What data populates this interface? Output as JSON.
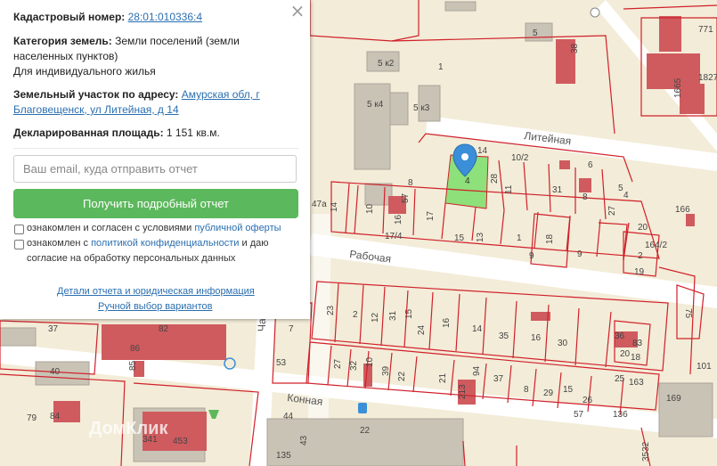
{
  "panel": {
    "close_icon": "×",
    "cadastral_label": "Кадастровый номер:",
    "cadastral_value": "28:01:010336:4",
    "category_label": "Категория земель:",
    "category_value_1": "Земли поселений (земли",
    "category_value_2": "населенных пунктов)",
    "category_value_3": "Для индивидуального жилья",
    "address_label": "Земельный участок по адресу:",
    "address_value_1": "Амурская обл, г",
    "address_value_2": "Благовещенск, ул Литейная, д 14",
    "area_label": "Декларированная площадь:",
    "area_value": "1 151 кв.м.",
    "email_placeholder": "Ваш email, куда отправить отчет",
    "submit_label": "Получить подробный отчет",
    "consent1_text": "ознакомлен и согласен с условиями",
    "consent1_link": "публичной оферты",
    "consent2_text_a": "ознакомлен с",
    "consent2_link_a": "политикой конфиденциальности",
    "consent2_text_b": "и даю",
    "consent2_link_b": "согласие на обработку персональных данных",
    "details_link": "Детали отчета и юридическая информация",
    "manual_link": "Ручной выбор вариантов"
  },
  "map": {
    "streets": {
      "liteynaya": "Литейная",
      "rabochaya": "Рабочая",
      "konnaya": "Конная",
      "cha": "Ча"
    },
    "labels": {
      "b5k2": "5 к2",
      "b5k4": "5 к4",
      "b5k3": "5 к3",
      "b5": "5",
      "b1": "1",
      "b38": "38",
      "b771": "771",
      "b1665": "1665",
      "b1827": "1827",
      "p14a": "14",
      "p10_2": "10/2",
      "p8a": "8",
      "p28": "28",
      "p11a": "11",
      "p31": "31",
      "p8b": "8",
      "p6": "6",
      "p5": "5",
      "p4": "4",
      "p27": "27",
      "p166": "166",
      "p47a": "47а",
      "p14b": "14",
      "p10a": "10",
      "p16": "16",
      "p57": "57",
      "p17": "17",
      "p15": "15",
      "p13": "13",
      "p1": "1",
      "p18": "18",
      "p9a": "9",
      "p9b": "9",
      "p20": "20",
      "p2": "2",
      "p19": "19",
      "p164": "164/2",
      "p1674": "17/4",
      "q23": "23",
      "q2": "2",
      "q12": "12",
      "q31": "31",
      "q15": "15",
      "q24": "24",
      "q16": "16",
      "q14": "14",
      "q35": "35",
      "q16b": "16",
      "q30": "30",
      "q36": "36",
      "q83": "83",
      "q20": "20",
      "q18": "18",
      "q75": "75",
      "q101": "101",
      "q7": "7",
      "q53": "53",
      "q27": "27",
      "q32": "32",
      "q10": "10",
      "q39": "39",
      "q22": "22",
      "q21": "21",
      "q94": "94",
      "q37": "37",
      "q8": "8",
      "q29": "29",
      "q15b": "15",
      "q26": "26",
      "q57": "57",
      "q25": "25",
      "q163": "163",
      "q136": "136",
      "r86": "86",
      "r82": "82",
      "r85": "85",
      "r40": "40",
      "r79": "79",
      "r84": "84",
      "r341": "341",
      "r453": "453",
      "r44": "44",
      "r22": "22",
      "r213": "213",
      "r43": "43",
      "r135": "135",
      "r169": "169",
      "r3532": "3532",
      "r37": "37",
      "sel4": "4"
    },
    "watermark": "ДомКлик"
  },
  "colors": {
    "map_bg": "#f3ecd8",
    "parcel_line": "#d0202a",
    "building": "#cf5b5f",
    "grey_building": "#c5c0b4",
    "selected": "#8ee07a",
    "marker": "#3b8fd8",
    "road": "#ffffff",
    "button": "#5cb85c"
  }
}
